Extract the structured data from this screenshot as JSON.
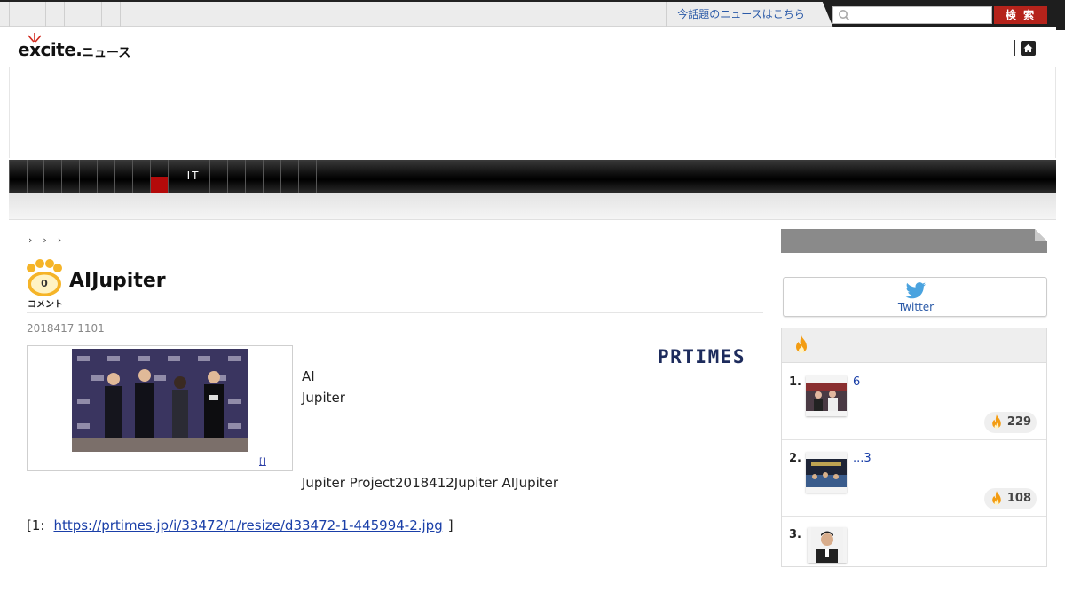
{
  "topbar": {
    "trend_link": "今話題のニュースはこちら",
    "search_placeholder": "",
    "search_button": "検 索"
  },
  "header": {
    "logo_text": "excite.",
    "logo_sub": "ニュース"
  },
  "nav": {
    "active_category": "IT"
  },
  "article": {
    "comment_count": "0",
    "comment_label": "コメント",
    "title": "AIJupiter",
    "date": "2018417 1101",
    "photo_caption": "[]",
    "body_line1": "AI",
    "body_line2": "Jupiter",
    "body_line3": "Jupiter Project2018412Jupiter AIJupiter",
    "ref_prefix": "[1:",
    "ref_link": "https://prtimes.jp/i/33472/1/resize/d33472-1-445994-2.jpg",
    "ref_suffix": "]",
    "source_logo": "PRTIMES"
  },
  "sidebar": {
    "twitter_label": "Twitter",
    "ranking": [
      {
        "rank": "1.",
        "title": "6",
        "count": "229"
      },
      {
        "rank": "2.",
        "title": "...3",
        "count": "108"
      },
      {
        "rank": "3.",
        "title": "",
        "count": ""
      }
    ]
  },
  "colors": {
    "accent_red": "#b5231b",
    "link_blue": "#1a3fa8",
    "nav_active": "#b40a0a",
    "flame_orange": "#f39c12"
  }
}
